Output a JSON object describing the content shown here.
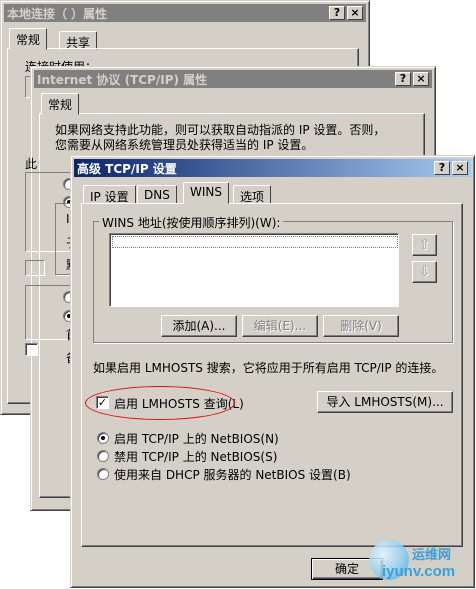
{
  "colors": {
    "dialog_bg": "#d4d0c8",
    "active_title_start": "#0a246a",
    "active_title_end": "#a6caf0",
    "inactive_title": "#808080",
    "annotation_red": "#e01010",
    "watermark_blue": "#3aa0d8"
  },
  "bg_dialog1": {
    "title": "本地连接（ ）属性",
    "title_buttons": [
      "?",
      "×"
    ],
    "tabs": [
      "常规",
      "共享"
    ],
    "partial_label": "连接时使用："
  },
  "bg_dialog2": {
    "title": "Internet 协议 (TCP/IP) 属性",
    "title_buttons": [
      "?",
      "×"
    ],
    "tabs": [
      "常规"
    ],
    "description": "如果网络支持此功能，则可以获取自动指派的 IP 设置。否则，您需要从网络系统管理员处获得适当的 IP 设置。",
    "left_fragments": [
      "此",
      "I",
      "子",
      "默",
      "首",
      "备"
    ]
  },
  "dialog": {
    "title": "高级 TCP/IP 设置",
    "title_buttons": [
      "?",
      "×"
    ],
    "tabs": [
      "IP 设置",
      "DNS",
      "WINS",
      "选项"
    ],
    "selected_tab": "WINS",
    "wins_group_label": "WINS 地址(按使用顺序排列)(W):",
    "wins_list_items": [],
    "up_arrow_icon": "arrow-up-icon",
    "down_arrow_icon": "arrow-down-icon",
    "buttons": {
      "add": "添加(A)...",
      "edit": "编辑(E)...",
      "delete": "删除(V)"
    },
    "lmhosts_description": "如果启用 LMHOSTS 搜索，它将应用于所有启用 TCP/IP 的连接。",
    "lmhosts_checkbox": {
      "label": "启用 LMHOSTS 查询(L)",
      "checked": true
    },
    "import_button": "导入 LMHOSTS(M)...",
    "netbios_options": [
      {
        "label": "启用 TCP/IP 上的 NetBIOS(N)",
        "selected": true
      },
      {
        "label": "禁用 TCP/IP 上的 NetBIOS(S)",
        "selected": false
      },
      {
        "label": "使用来自 DHCP 服务器的 NetBIOS 设置(B)",
        "selected": false
      }
    ],
    "ok_button": "确定"
  },
  "watermark": {
    "line1": "运维网",
    "line2": "iyunv.com"
  }
}
